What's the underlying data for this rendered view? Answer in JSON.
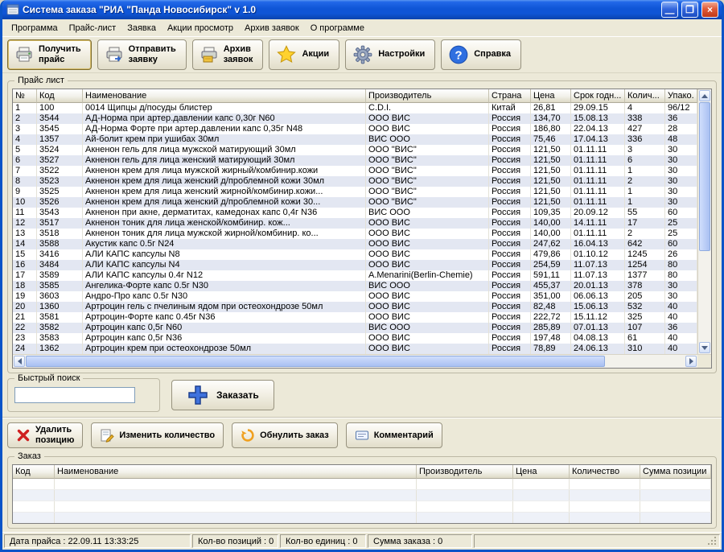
{
  "window": {
    "title": "Система заказа \"РИА \"Панда Новосибирск\" v 1.0"
  },
  "titlebar_buttons": {
    "minimize": "—",
    "maximize": "❐",
    "close": "×"
  },
  "menu": {
    "items": [
      "Программа",
      "Прайс-лист",
      "Заявка",
      "Акции просмотр",
      "Архив заявок",
      "О программе"
    ]
  },
  "toolbar": {
    "buttons": [
      {
        "label": "Получить\nпрайс",
        "icon": "printer-download-icon"
      },
      {
        "label": "Отправить\nзаявку",
        "icon": "printer-send-icon"
      },
      {
        "label": "Архив\nзаявок",
        "icon": "archive-icon"
      },
      {
        "label": "Акции",
        "icon": "star-icon"
      },
      {
        "label": "Настройки",
        "icon": "gear-icon"
      },
      {
        "label": "Справка",
        "icon": "help-icon"
      }
    ]
  },
  "pricelist": {
    "title": "Прайс лист",
    "columns": [
      "№",
      "Код",
      "Наименование",
      "Производитель",
      "Страна",
      "Цена",
      "Срок годн...",
      "Колич...",
      "Упако."
    ],
    "rows": [
      [
        "1",
        "100",
        "0014 Щипцы д/посуды блистер",
        "C.D.I.",
        "Китай",
        "26,81",
        "29.09.15",
        "4",
        "96/12"
      ],
      [
        "2",
        "3544",
        "АД-Норма при артер.давлении капс 0,30г N60",
        "ООО ВИС",
        "Россия",
        "134,70",
        "15.08.13",
        "338",
        "36"
      ],
      [
        "3",
        "3545",
        "АД-Норма Форте при артер.давлении капс 0,35г N48",
        "ООО ВИС",
        "Россия",
        "186,80",
        "22.04.13",
        "427",
        "28"
      ],
      [
        "4",
        "1357",
        "Ай-болит крем при ушибах 30мл",
        "ВИС ООО",
        "Россия",
        "75,46",
        "17.04.13",
        "336",
        "48"
      ],
      [
        "5",
        "3524",
        "Акненон гель для лица мужской матирующий 30мл",
        "ООО \"ВИС\"",
        "Россия",
        "121,50",
        "01.11.11",
        "3",
        "30"
      ],
      [
        "6",
        "3527",
        "Акненон гель для лица женский матирующий 30мл",
        "ООО \"ВИС\"",
        "Россия",
        "121,50",
        "01.11.11",
        "6",
        "30"
      ],
      [
        "7",
        "3522",
        "Акненон крем для лица мужской жирный/комбинир.кожи",
        "ООО \"ВИС\"",
        "Россия",
        "121,50",
        "01.11.11",
        "1",
        "30"
      ],
      [
        "8",
        "3523",
        "Акненон крем для лица женский д/проблемной кожи 30мл",
        "ООО \"ВИС\"",
        "Россия",
        "121,50",
        "01.11.11",
        "2",
        "30"
      ],
      [
        "9",
        "3525",
        "Акненон крем для лица женский жирной/комбинир.кожи...",
        "ООО \"ВИС\"",
        "Россия",
        "121,50",
        "01.11.11",
        "1",
        "30"
      ],
      [
        "10",
        "3526",
        "Акненон крем для лица женский д/проблемной кожи 30...",
        "ООО \"ВИС\"",
        "Россия",
        "121,50",
        "01.11.11",
        "1",
        "30"
      ],
      [
        "11",
        "3543",
        "Акненон при акне, дерматитах, камедонах капс 0,4г N36",
        "ВИС ООО",
        "Россия",
        "109,35",
        "20.09.12",
        "55",
        "60"
      ],
      [
        "12",
        "3517",
        "Акненон тоник для лица женской/комбинир. кож...",
        "ООО ВИС",
        "Россия",
        "140,00",
        "14.11.11",
        "17",
        "25"
      ],
      [
        "13",
        "3518",
        "Акненон тоник для лица мужской жирной/комбинир. ко...",
        "ООО ВИС",
        "Россия",
        "140,00",
        "01.11.11",
        "2",
        "25"
      ],
      [
        "14",
        "3588",
        "Акустик капс 0.5г N24",
        "ООО ВИС",
        "Россия",
        "247,62",
        "16.04.13",
        "642",
        "60"
      ],
      [
        "15",
        "3416",
        "АЛИ КАПС капсулы N8",
        "ООО ВИС",
        "Россия",
        "479,86",
        "01.10.12",
        "1245",
        "26"
      ],
      [
        "16",
        "3484",
        "АЛИ КАПС капсулы N4",
        "ООО ВИС",
        "Россия",
        "254,59",
        "11.07.13",
        "1254",
        "80"
      ],
      [
        "17",
        "3589",
        "АЛИ КАПС капсулы 0.4г N12",
        "A.Menarini(Berlin-Chemie)",
        "Россия",
        "591,11",
        "11.07.13",
        "1377",
        "80"
      ],
      [
        "18",
        "3585",
        "Ангелика-Форте капс 0.5г N30",
        "ВИС ООО",
        "Россия",
        "455,37",
        "20.01.13",
        "378",
        "30"
      ],
      [
        "19",
        "3603",
        "Андро-Про капс 0.5г N30",
        "ООО ВИС",
        "Россия",
        "351,00",
        "06.06.13",
        "205",
        "30"
      ],
      [
        "20",
        "1360",
        "Артроцин гель с пчелиным ядом при остеохондрозе 50мл",
        "ООО ВИС",
        "Россия",
        "82,48",
        "15.06.13",
        "532",
        "40"
      ],
      [
        "21",
        "3581",
        "Артроцин-Форте капс 0.45г N36",
        "ООО ВИС",
        "Россия",
        "222,72",
        "15.11.12",
        "325",
        "40"
      ],
      [
        "22",
        "3582",
        "Артроцин капс 0,5г N60",
        "ВИС ООО",
        "Россия",
        "285,89",
        "07.01.13",
        "107",
        "36"
      ],
      [
        "23",
        "3583",
        "Артроцин капс 0,5г N36",
        "ООО ВИС",
        "Россия",
        "197,48",
        "04.08.13",
        "61",
        "40"
      ],
      [
        "24",
        "1362",
        "Артроцин крем при остеохондрозе 50мл",
        "ООО ВИС",
        "Россия",
        "78,89",
        "24.06.13",
        "310",
        "40"
      ]
    ]
  },
  "search": {
    "title": "Быстрый поиск",
    "value": ""
  },
  "order_button": {
    "label": "Заказать",
    "icon": "plus-icon"
  },
  "actions": [
    {
      "label": "Удалить\nпозицию",
      "icon": "red-x-icon"
    },
    {
      "label": "Изменить количество",
      "icon": "edit-icon"
    },
    {
      "label": "Обнулить заказ",
      "icon": "reset-icon"
    },
    {
      "label": "Комментарий",
      "icon": "comment-icon"
    }
  ],
  "order": {
    "title": "Заказ",
    "columns": [
      "Код",
      "Наименование",
      "Производитель",
      "Цена",
      "Количество",
      "Сумма позиции"
    ],
    "empty_row_count": 7
  },
  "statusbar": {
    "price_date": "Дата прайса : 22.09.11 13:33:25",
    "positions": "Кол-во позиций : 0",
    "units": "Кол-во единиц : 0",
    "total": "Сумма заказа : 0"
  },
  "colors": {
    "titlebar_blue": "#0f55d6",
    "client_bg": "#ece9d8",
    "row_alt": "#e3e7f2",
    "close_red": "#e05a38",
    "star_yellow": "#ffd22e",
    "plus_blue": "#3f72dd"
  }
}
